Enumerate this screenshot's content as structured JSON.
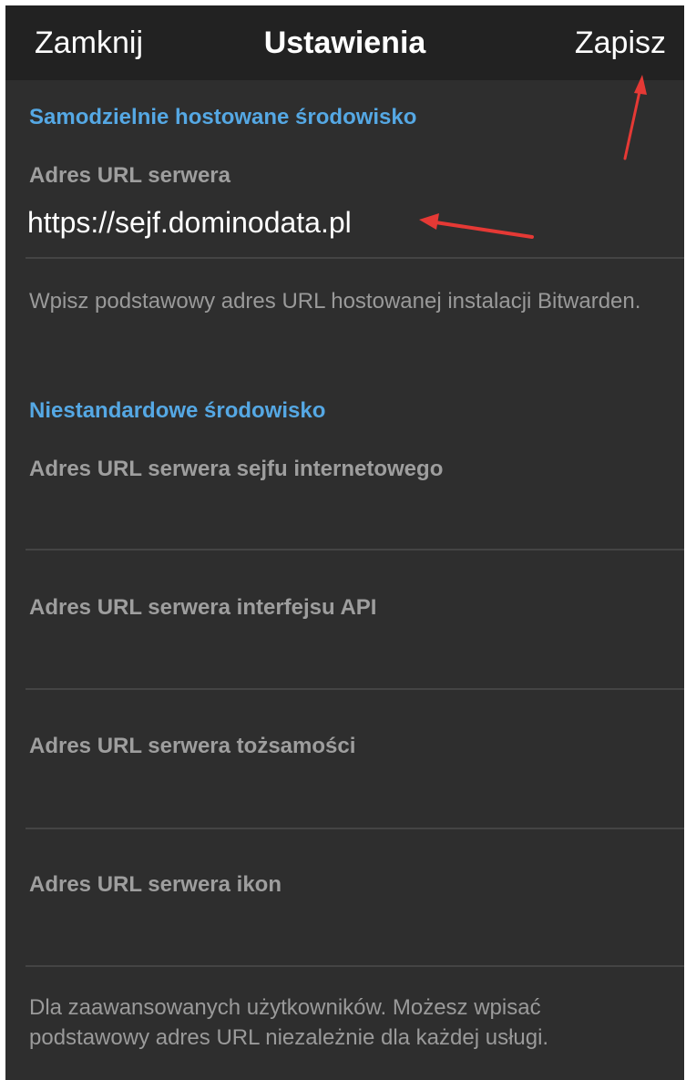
{
  "navbar": {
    "close_label": "Zamknij",
    "title": "Ustawienia",
    "save_label": "Zapisz"
  },
  "self_hosted": {
    "section_title": "Samodzielnie hostowane środowisko",
    "server_url_label": "Adres URL serwera",
    "server_url_value": "https://sejf.dominodata.pl",
    "hint": "Wpisz podstawowy adres URL hostowanej instalacji Bitwarden."
  },
  "custom": {
    "section_title": "Niestandardowe środowisko",
    "fields": [
      {
        "label": "Adres URL serwera sejfu internetowego",
        "value": ""
      },
      {
        "label": "Adres URL serwera interfejsu API",
        "value": ""
      },
      {
        "label": "Adres URL serwera tożsamości",
        "value": ""
      },
      {
        "label": "Adres URL serwera ikon",
        "value": ""
      }
    ],
    "hint": "Dla zaawansowanych użytkowników. Możesz wpisać podstawowy adres URL niezależnie dla każdej usługi."
  },
  "colors": {
    "accent": "#55a8e4",
    "background": "#2e2e2e",
    "navbar": "#222222",
    "annotation_arrow": "#e53935"
  }
}
